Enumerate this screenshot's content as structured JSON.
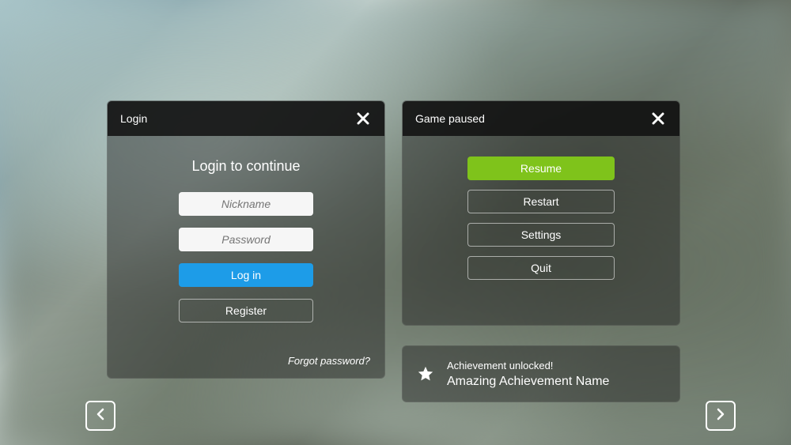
{
  "login": {
    "panel_title": "Login",
    "heading": "Login to continue",
    "nickname_placeholder": "Nickname",
    "password_placeholder": "Password",
    "login_button": "Log in",
    "register_button": "Register",
    "forgot_link": "Forgot password?"
  },
  "pause": {
    "panel_title": "Game paused",
    "resume": "Resume",
    "restart": "Restart",
    "settings": "Settings",
    "quit": "Quit"
  },
  "achievement": {
    "unlocked_label": "Achievement unlocked!",
    "name": "Amazing Achievement Name"
  },
  "colors": {
    "blue": "#1d9ce8",
    "green": "#7fc31b"
  }
}
